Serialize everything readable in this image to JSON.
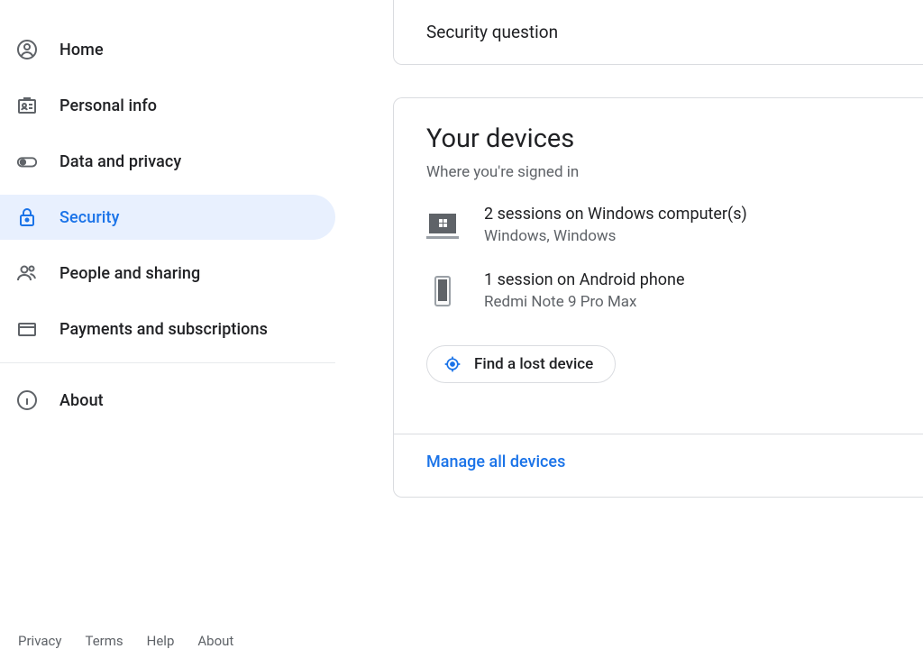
{
  "sidebar": {
    "items": [
      {
        "label": "Home"
      },
      {
        "label": "Personal info"
      },
      {
        "label": "Data and privacy"
      },
      {
        "label": "Security"
      },
      {
        "label": "People and sharing"
      },
      {
        "label": "Payments and subscriptions"
      },
      {
        "label": "About"
      }
    ]
  },
  "footer": {
    "privacy": "Privacy",
    "terms": "Terms",
    "help": "Help",
    "about": "About"
  },
  "top_card": {
    "title": "Security question"
  },
  "devices_card": {
    "title": "Your devices",
    "subtitle": "Where you're signed in",
    "items": [
      {
        "line1": "2 sessions on Windows computer(s)",
        "line2": "Windows, Windows"
      },
      {
        "line1": "1 session on Android phone",
        "line2": "Redmi Note 9 Pro Max"
      }
    ],
    "find_lost": "Find a lost device",
    "manage_all": "Manage all devices"
  }
}
